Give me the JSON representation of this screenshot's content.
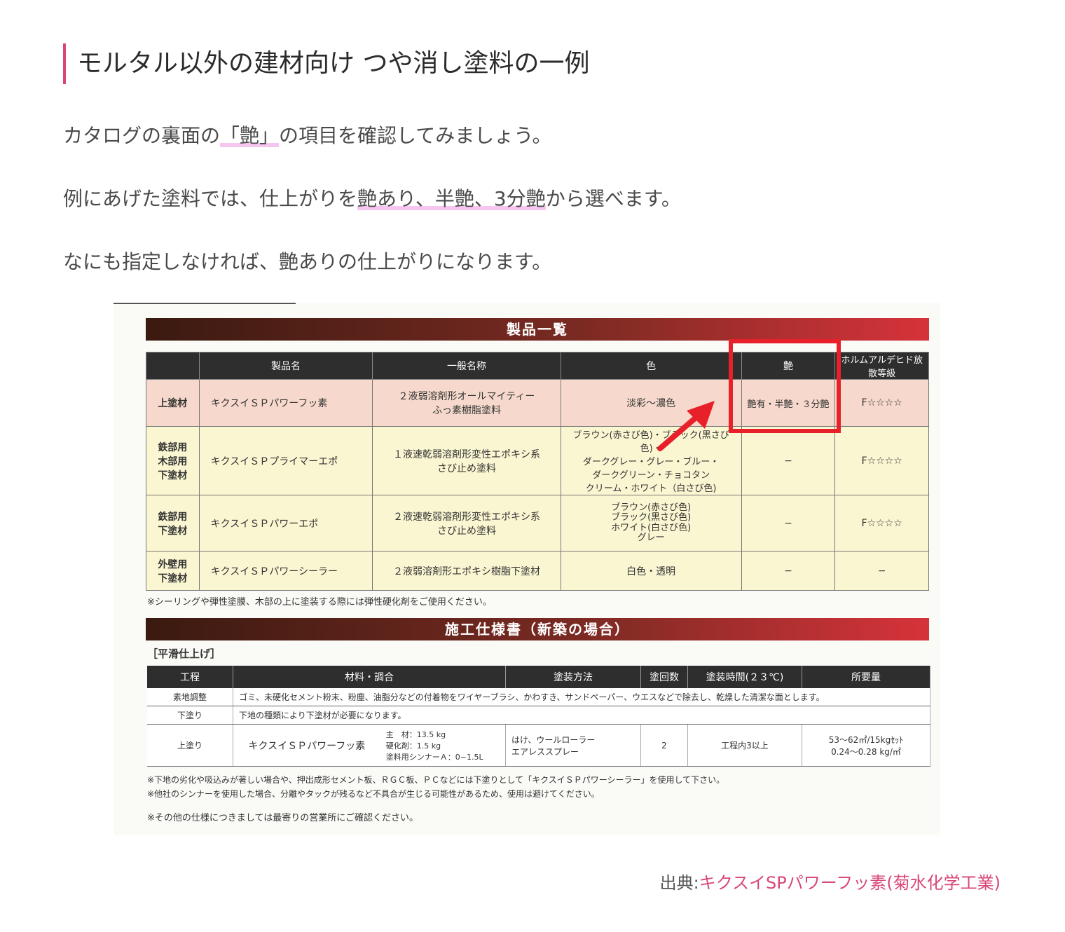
{
  "heading": "モルタル以外の建材向け つや消し塗料の一例",
  "para1": {
    "pre": "カタログの裏面の",
    "hl": "「艶」",
    "post": "の項目を確認してみましょう。"
  },
  "para2": {
    "pre": "例にあげた塗料では、仕上がりを",
    "hl": "艶あり、半艶、3分艶",
    "post": "から選べます。"
  },
  "para3": "なにも指定しなければ、艶ありの仕上がりになります。",
  "catalog": {
    "banner1": "製品一覧",
    "headers": [
      "",
      "製品名",
      "一般名称",
      "色",
      "艶",
      "ホルムアルデヒド放散等級"
    ],
    "rows": [
      {
        "cat": "上塗材",
        "name": "キクスイＳＰパワーフッ素",
        "general": "２液弱溶剤形オールマイティー\nふっ素樹脂塗料",
        "color": "淡彩〜濃色",
        "gloss": "艶有・半艶・３分艶",
        "grade": "F☆☆☆☆"
      },
      {
        "cat": "鉄部用\n木部用\n下塗材",
        "name": "キクスイＳＰプライマーエポ",
        "general": "１液速乾弱溶剤形変性エポキシ系\nさび止め塗料",
        "color": "ブラウン(赤さび色)・ブラック(黒さび色)・\nダークグレー・グレー・ブルー・\nダークグリーン・チョコタン\nクリーム・ホワイト（白さび色)",
        "gloss": "−",
        "grade": "F☆☆☆☆"
      },
      {
        "cat": "鉄部用\n下塗材",
        "name": "キクスイＳＰパワーエポ",
        "general": "２液速乾弱溶剤形変性エポキシ系\nさび止め塗料",
        "color": "ブラウン(赤さび色)\nブラック(黒さび色)\nホワイト(白さび色)\nグレー",
        "gloss": "−",
        "grade": "F☆☆☆☆"
      },
      {
        "cat": "外壁用\n下塗材",
        "name": "キクスイＳＰパワーシーラー",
        "general": "２液弱溶剤形エポキシ樹脂下塗材",
        "color": "白色・透明",
        "gloss": "−",
        "grade": "−"
      }
    ],
    "note1": "※シーリングや弾性塗膜、木部の上に塗装する際には弾性硬化剤をご使用ください。",
    "banner2": "施工仕様書（新築の場合）",
    "subhead": "［平滑仕上げ］",
    "spec_headers": [
      "工程",
      "材料・調合",
      "塗装方法",
      "塗回数",
      "塗装時間(２３℃)",
      "所要量"
    ],
    "spec_row1": {
      "step": "素地調整",
      "desc": "ゴミ、未硬化セメント粉末、粉塵、油脂分などの付着物をワイヤーブラシ、かわすき、サンドペーパー、ウエスなどで除去し、乾燥した清潔な面とします。"
    },
    "spec_row2": {
      "step": "下塗り",
      "desc": "下地の種類により下塗材が必要になります。"
    },
    "spec_row3": {
      "step": "上塗り",
      "material": "キクスイＳＰパワーフッ素",
      "mix": "主　材：13.5 kg\n硬化剤：1.5 kg\n塗料用シンナーＡ：0~1.5L",
      "method": "はけ、ウールローラー\nエアレススプレー",
      "coats": "2",
      "time": "工程内3以上",
      "amount": "53〜62㎡/15kgｾｯﾄ\n0.24〜0.28 kg/㎡"
    },
    "notes2": [
      "※下地の劣化や吸込みが著しい場合や、押出成形セメント板、ＲＧＣ板、ＰＣなどには下塗りとして「キクスイＳＰパワーシーラー」を使用して下さい。",
      "※他社のシンナーを使用した場合、分離やタックが残るなど不具合が生じる可能性があるため、使用は避けてください。"
    ],
    "note3": "※その他の仕様につきましては最寄りの営業所にご確認ください。"
  },
  "citation": {
    "label": "出典:",
    "link": "キクスイSPパワーフッ素(菊水化学工業)"
  },
  "colors": {
    "accent": "#d9477a",
    "highlight": "#f6c6f0",
    "callout": "#e8202a"
  }
}
